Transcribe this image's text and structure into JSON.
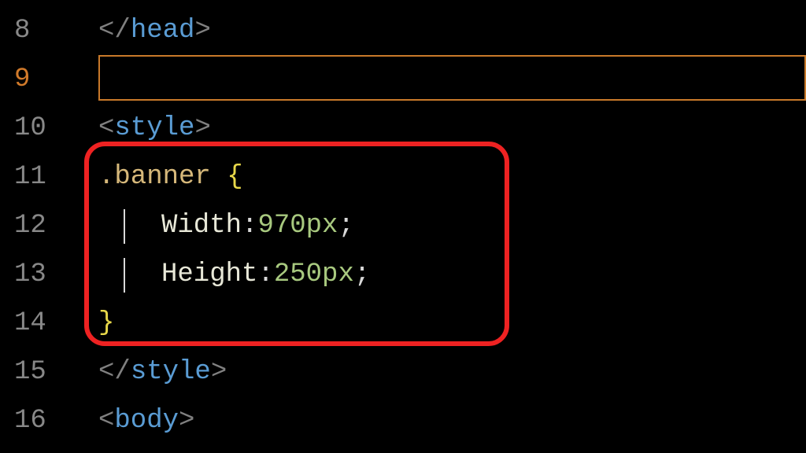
{
  "editor": {
    "current_line": 9,
    "lines": [
      {
        "num": 8,
        "tokens": [
          {
            "t": "</",
            "c": "bracket"
          },
          {
            "t": "head",
            "c": "tag"
          },
          {
            "t": ">",
            "c": "bracket"
          }
        ],
        "indent": "base"
      },
      {
        "num": 9,
        "tokens": [],
        "indent": "base",
        "current": true
      },
      {
        "num": 10,
        "tokens": [
          {
            "t": "<",
            "c": "bracket"
          },
          {
            "t": "style",
            "c": "tag"
          },
          {
            "t": ">",
            "c": "bracket"
          }
        ],
        "indent": "base"
      },
      {
        "num": 11,
        "tokens": [
          {
            "t": ".banner ",
            "c": "selector"
          },
          {
            "t": "{",
            "c": "brace"
          }
        ],
        "indent": "rule"
      },
      {
        "num": 12,
        "tokens": [
          {
            "t": "Width",
            "c": "prop"
          },
          {
            "t": ":",
            "c": "punct"
          },
          {
            "t": "970px",
            "c": "value"
          },
          {
            "t": ";",
            "c": "semi"
          }
        ],
        "indent": "prop",
        "guide": true
      },
      {
        "num": 13,
        "tokens": [
          {
            "t": "Height",
            "c": "prop"
          },
          {
            "t": ":",
            "c": "punct"
          },
          {
            "t": "250px",
            "c": "value"
          },
          {
            "t": ";",
            "c": "semi"
          }
        ],
        "indent": "prop",
        "guide": true
      },
      {
        "num": 14,
        "tokens": [
          {
            "t": "}",
            "c": "brace"
          }
        ],
        "indent": "rule"
      },
      {
        "num": 15,
        "tokens": [
          {
            "t": "</",
            "c": "bracket"
          },
          {
            "t": "style",
            "c": "tag"
          },
          {
            "t": ">",
            "c": "bracket"
          }
        ],
        "indent": "base"
      },
      {
        "num": 16,
        "tokens": [
          {
            "t": "<",
            "c": "bracket"
          },
          {
            "t": "body",
            "c": "tag"
          },
          {
            "t": ">",
            "c": "bracket"
          }
        ],
        "indent": "base"
      }
    ]
  },
  "annotation": {
    "highlight_lines_start": 11,
    "highlight_lines_end": 14
  }
}
